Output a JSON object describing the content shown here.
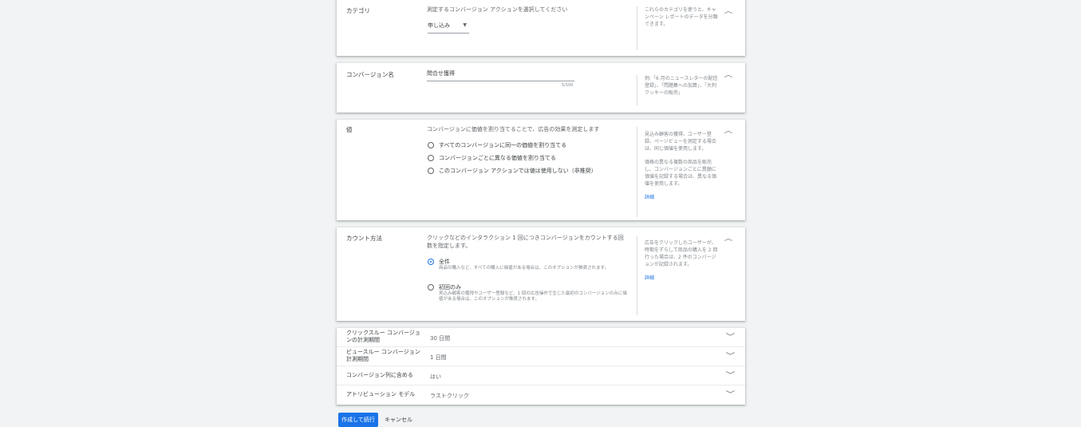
{
  "category": {
    "label": "カテゴリ",
    "description": "測定するコンバージョン アクションを選択してください",
    "selected": "申し込み",
    "help": "これらのカテゴリを使うと、キャンペーン レポートのデータを分類できます。"
  },
  "conversion_name": {
    "label": "コンバージョン名",
    "value": "問合せ獲得",
    "counter": "5/100",
    "help": "例:「6 月のニュースレターの配信登録」、「問題集への加算」、「大判クッキーの販売」"
  },
  "value": {
    "label": "値",
    "description": "コンバージョンに価値を割り当てることで、広告の効果を測定します",
    "options": [
      "すべてのコンバージョンに同一の価値を割り当てる",
      "コンバージョンごとに異なる価値を割り当てる",
      "このコンバージョン アクションでは値は使用しない（非推奨）"
    ],
    "help_1": "見込み顧客の獲得、ユーザー登録、ページビューを測定する場合は、同じ価値を使用します。",
    "help_2": "価格の異なる複数の商品を販売し、コンバージョンごとに異額に価値を記録する場合は、異なる価値を使用します。",
    "help_link": "詳細"
  },
  "count": {
    "label": "カウント方法",
    "description": "クリックなどのインタラクション 1 回につきコンバージョンをカウントする回数を指定します。",
    "opt1_label": "全件",
    "opt1_sub": "商品の購入など、すべての購入に価値がある場合は、このオプションが推奨されます。",
    "opt2_label": "初回のみ",
    "opt2_sub": "見込み顧客の獲得やユーザー登録など、1 回の広告操作で生じた最初のコンバージョンのみに価値がある場合は、このオプションが推奨されます。",
    "help": "広告をクリックしたユーザーが、時期をずらして商品の購入を 2 回行った場合は、2 件のコンバージョンが記録されます。",
    "help_link": "詳細"
  },
  "settings": [
    {
      "label": "クリックスルー コンバージョンの計測期間",
      "value": "30 日間"
    },
    {
      "label": "ビュースルー コンバージョン計測期間",
      "value": "1 日間"
    },
    {
      "label": "コンバージョン列に含める",
      "value": "はい"
    },
    {
      "label": "アトリビューション モデル",
      "value": "ラストクリック"
    }
  ],
  "actions": {
    "primary": "作成して続行",
    "cancel": "キャンセル"
  },
  "colors": {
    "accent": "#1a73e8",
    "background": "#f1f3f4"
  }
}
